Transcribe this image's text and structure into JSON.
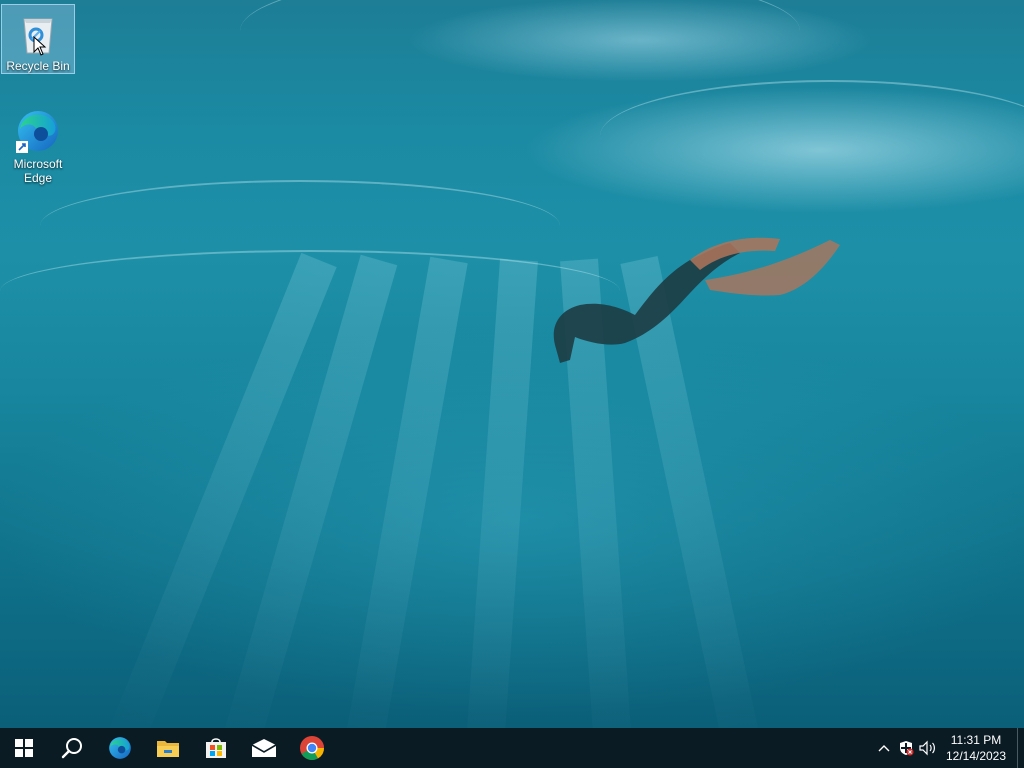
{
  "desktop": {
    "icons": [
      {
        "label": "Recycle Bin",
        "icon": "recycle-bin-icon"
      },
      {
        "label": "Microsoft Edge",
        "icon": "edge-icon"
      }
    ]
  },
  "taskbar": {
    "buttons": [
      {
        "icon": "windows-start-icon"
      },
      {
        "icon": "search-icon"
      },
      {
        "icon": "edge-icon"
      },
      {
        "icon": "file-explorer-icon"
      },
      {
        "icon": "microsoft-store-icon"
      },
      {
        "icon": "mail-icon"
      },
      {
        "icon": "chrome-icon"
      }
    ],
    "tray": {
      "icons": [
        "chevron-up-icon",
        "security-shield-icon",
        "volume-icon"
      ],
      "time": "11:31 PM",
      "date": "12/14/2023"
    }
  },
  "colors": {
    "taskbar": "#0b1b24",
    "water": "#1b8aa3"
  }
}
